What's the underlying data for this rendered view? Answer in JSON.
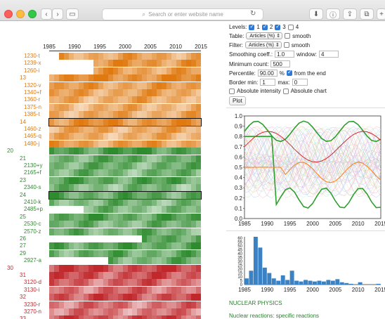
{
  "browser": {
    "address_placeholder": "Search or enter website name",
    "icons": [
      "back-icon",
      "forward-icon",
      "sidebar-icon",
      "reload-icon",
      "download-icon",
      "info-icon",
      "share-icon",
      "tabs-icon",
      "new-tab-icon"
    ]
  },
  "heatmap": {
    "axis_ticks": [
      "1985",
      "1990",
      "1995",
      "2000",
      "2005",
      "2010",
      "2015"
    ],
    "colors": {
      "orange": "#e07a10",
      "green": "#2e8b2e",
      "red": "#c0282c",
      "orange_light": "#f6d2b0",
      "green_light": "#cfe8c9",
      "red_light": "#f3c2c0"
    },
    "rows": [
      {
        "label": "1230-t",
        "group": "orange",
        "indent": 1,
        "level": 0.55,
        "start": 0.08
      },
      {
        "label": "1239-x",
        "group": "orange",
        "indent": 1,
        "level": 0.7,
        "start": 0.28
      },
      {
        "label": "1260-i",
        "group": "orange",
        "indent": 1,
        "level": 0.6,
        "start": 0.28
      },
      {
        "label": "13",
        "group": "orange",
        "indent": 0,
        "level": 0.8,
        "start": 0.0
      },
      {
        "label": "1320-v",
        "group": "orange",
        "indent": 1,
        "level": 0.6,
        "start": 0.0
      },
      {
        "label": "1340+f",
        "group": "orange",
        "indent": 1,
        "level": 0.55,
        "start": 0.0
      },
      {
        "label": "1360-r",
        "group": "orange",
        "indent": 1,
        "level": 0.5,
        "start": 0.0
      },
      {
        "label": "1375-n",
        "group": "orange",
        "indent": 1,
        "level": 0.45,
        "start": 0.0
      },
      {
        "label": "1385-t",
        "group": "orange",
        "indent": 1,
        "level": 0.5,
        "start": 0.0
      },
      {
        "label": "14",
        "group": "orange",
        "indent": 0,
        "level": 0.75,
        "start": 0.0
      },
      {
        "label": "1460-z",
        "group": "orange",
        "indent": 1,
        "level": 0.5,
        "start": 0.0
      },
      {
        "label": "1465-q",
        "group": "orange",
        "indent": 1,
        "level": 0.45,
        "start": 0.0
      },
      {
        "label": "1480-j",
        "group": "orange",
        "indent": 1,
        "level": 0.6,
        "start": 0.0
      },
      {
        "label": "20",
        "group": "green",
        "indent": -1,
        "level": 0.8,
        "start": 0.0
      },
      {
        "label": "21",
        "group": "green",
        "indent": 0,
        "level": 0.6,
        "start": 0.0
      },
      {
        "label": "2130+y",
        "group": "green",
        "indent": 1,
        "level": 0.55,
        "start": 0.0
      },
      {
        "label": "2165+f",
        "group": "green",
        "indent": 1,
        "level": 0.5,
        "start": 0.0
      },
      {
        "label": "23",
        "group": "green",
        "indent": 0,
        "level": 0.7,
        "start": 0.0
      },
      {
        "label": "2340-s",
        "group": "green",
        "indent": 1,
        "level": 0.45,
        "start": 0.0
      },
      {
        "label": "24",
        "group": "green",
        "indent": 0,
        "level": 0.65,
        "start": 0.0
      },
      {
        "label": "2410-k",
        "group": "green",
        "indent": 1,
        "level": 0.5,
        "start": 0.0
      },
      {
        "label": "2485+p",
        "group": "green",
        "indent": 1,
        "level": 0.45,
        "start": 0.22
      },
      {
        "label": "25",
        "group": "green",
        "indent": 0,
        "level": 0.7,
        "start": 0.0
      },
      {
        "label": "2530-c",
        "group": "green",
        "indent": 1,
        "level": 0.5,
        "start": 0.0
      },
      {
        "label": "2570-z",
        "group": "green",
        "indent": 1,
        "level": 0.55,
        "start": 0.0
      },
      {
        "label": "26",
        "group": "green",
        "indent": 0,
        "level": 0.75,
        "start": 0.62
      },
      {
        "label": "27",
        "group": "green",
        "indent": 0,
        "level": 0.7,
        "start": 0.0
      },
      {
        "label": "29",
        "group": "green",
        "indent": 0,
        "level": 0.6,
        "start": 0.0
      },
      {
        "label": "2927-a",
        "group": "green",
        "indent": 1,
        "level": 0.55,
        "start": 0.38
      },
      {
        "label": "30",
        "group": "red",
        "indent": -1,
        "level": 0.8,
        "start": 0.0
      },
      {
        "label": "31",
        "group": "red",
        "indent": 0,
        "level": 0.7,
        "start": 0.0
      },
      {
        "label": "3120-d",
        "group": "red",
        "indent": 1,
        "level": 0.6,
        "start": 0.0
      },
      {
        "label": "3130-i",
        "group": "red",
        "indent": 1,
        "level": 0.55,
        "start": 0.0
      },
      {
        "label": "32",
        "group": "red",
        "indent": 0,
        "level": 0.75,
        "start": 0.0
      },
      {
        "label": "3230-r",
        "group": "red",
        "indent": 1,
        "level": 0.5,
        "start": 0.0
      },
      {
        "label": "3270-n",
        "group": "red",
        "indent": 1,
        "level": 0.45,
        "start": 0.0
      },
      {
        "label": "33",
        "group": "red",
        "indent": 0,
        "level": 0.7,
        "start": 0.0
      }
    ]
  },
  "controls": {
    "levels_label": "Levels:",
    "levels": [
      {
        "label": "1",
        "checked": true
      },
      {
        "label": "2",
        "checked": true
      },
      {
        "label": "3",
        "checked": true
      },
      {
        "label": "4",
        "checked": false
      }
    ],
    "table_label": "Table:",
    "table_value": "Articles (%)",
    "smooth_label": "smooth",
    "filter_label": "Filter:",
    "filter_value": "Articles (%)",
    "smoothing_label": "Smoothing coeff.:",
    "smoothing_value": "1.0",
    "window_label": "window:",
    "window_value": "4",
    "min_count_label": "Minimum count:",
    "min_count_value": "500",
    "percentile_label": "Percentile:",
    "percentile_value": "90.00",
    "percentile_unit": "%",
    "from_end_label": "from the end",
    "border_min_label": "Border min:",
    "border_min_value": "1",
    "max_label": "max:",
    "max_value": "0",
    "abs_intensity_label": "Absolute intensity",
    "abs_chart_label": "Absolute chart",
    "plot_label": "Plot"
  },
  "line_chart": {
    "y_ticks": [
      "1.0",
      "0.9",
      "0.8",
      "0.7",
      "0.6",
      "0.5",
      "0.4",
      "0.3",
      "0.2",
      "0.1",
      "0.0"
    ],
    "x_ticks": [
      "1985",
      "1990",
      "1995",
      "2000",
      "2005",
      "2010",
      "2015"
    ]
  },
  "chart_data": {
    "type": "bar",
    "x": [
      1985,
      1986,
      1987,
      1988,
      1989,
      1990,
      1991,
      1992,
      1993,
      1994,
      1995,
      1996,
      1997,
      1998,
      1999,
      2000,
      2001,
      2002,
      2003,
      2004,
      2005,
      2006,
      2007,
      2008,
      2009,
      2010,
      2011,
      2012,
      2013,
      2014,
      2015
    ],
    "values": [
      8,
      18,
      62,
      48,
      22,
      15,
      8,
      5,
      12,
      6,
      18,
      5,
      4,
      6,
      5,
      4,
      5,
      4,
      6,
      5,
      7,
      3,
      2,
      1,
      0,
      3,
      0,
      0,
      0,
      1,
      0
    ],
    "y_ticks": [
      "0",
      "5",
      "10",
      "15",
      "20",
      "25",
      "30",
      "35",
      "40",
      "45",
      "50",
      "55",
      "60"
    ],
    "x_ticks": [
      "1985",
      "1990",
      "1995",
      "2000",
      "2005",
      "2010",
      "2015"
    ],
    "ylim": [
      0,
      62
    ],
    "xlim": [
      1985,
      2015
    ]
  },
  "section": {
    "title": "NUCLEAR PHYSICS",
    "subtitle": "Nuclear reactions: specific reactions"
  }
}
